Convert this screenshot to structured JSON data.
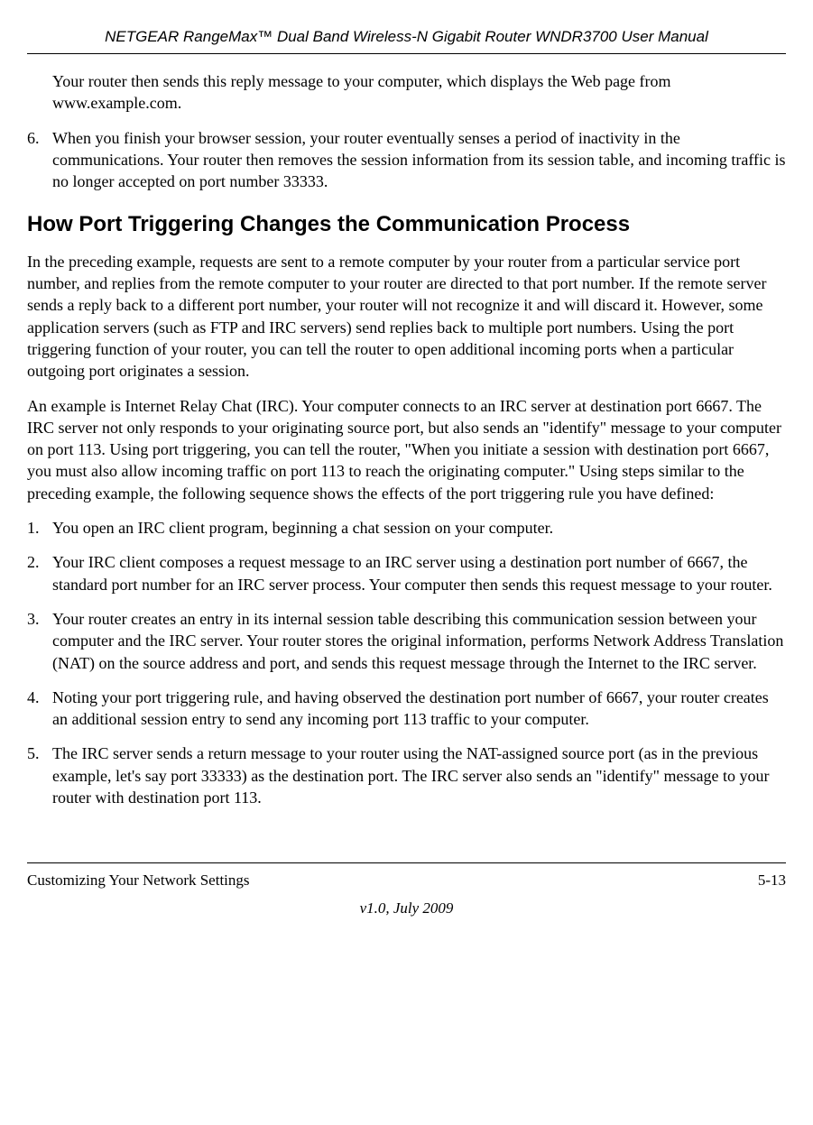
{
  "header": {
    "title": "NETGEAR RangeMax™ Dual Band Wireless-N Gigabit Router WNDR3700 User Manual"
  },
  "intro_para": "Your router then sends this reply message to your computer, which displays the Web page from www.example.com.",
  "list_top": {
    "num": "6.",
    "text": "When you finish your browser session, your router eventually senses a period of inactivity in the communications. Your router then removes the session information from its session table, and incoming traffic is no longer accepted on port number 33333."
  },
  "section_heading": "How Port Triggering Changes the Communication Process",
  "para1": "In the preceding example, requests are sent to a remote computer by your router from a particular service port number, and replies from the remote computer to your router are directed to that port number. If the remote server sends a reply back to a different port number, your router will not recognize it and will discard it. However, some application servers (such as FTP and IRC servers) send replies back to multiple port numbers. Using the port triggering function of your router, you can tell the router to open additional incoming ports when a particular outgoing port originates a session.",
  "para2": "An example is Internet Relay Chat (IRC). Your computer connects to an IRC server at destination port 6667. The IRC server not only responds to your originating source port, but also sends an \"identify\" message to your computer on port 113. Using port triggering, you can tell the router, \"When you initiate a session with destination port 6667, you must also allow incoming traffic on port 113 to reach the originating computer.\" Using steps similar to the preceding example, the following sequence shows the effects of the port triggering rule you have defined:",
  "steps": [
    {
      "num": "1.",
      "text": "You open an IRC client program, beginning a chat session on your computer."
    },
    {
      "num": "2.",
      "text": "Your IRC client composes a request message to an IRC server using a destination port number of 6667, the standard port number for an IRC server process. Your computer then sends this request message to your router."
    },
    {
      "num": "3.",
      "text": "Your router creates an entry in its internal session table describing this communication session between your computer and the IRC server. Your router stores the original information, performs Network Address Translation (NAT) on the source address and port, and sends this request message through the Internet to the IRC server."
    },
    {
      "num": "4.",
      "text": "Noting your port triggering rule, and having observed the destination port number of 6667, your router creates an additional session entry to send any incoming port 113 traffic to your computer."
    },
    {
      "num": "5.",
      "text": "The IRC server sends a return message to your router using the NAT-assigned source port (as in the previous example, let's say port 33333) as the destination port. The IRC server also sends an \"identify\" message to your router with destination port 113."
    }
  ],
  "footer": {
    "left": "Customizing Your Network Settings",
    "right": "5-13",
    "version": "v1.0, July 2009"
  }
}
